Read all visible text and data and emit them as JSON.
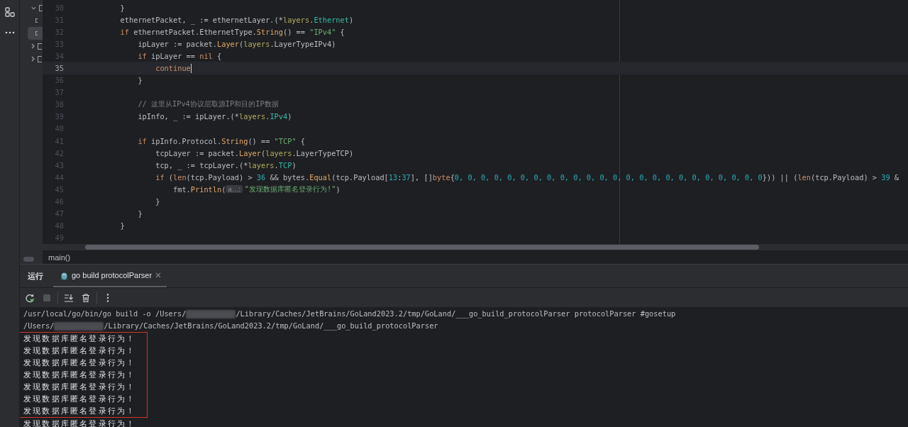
{
  "project_tree": [
    {
      "expanded": true,
      "selected": false,
      "children": [
        {
          "selected": false
        },
        {
          "selected": true
        }
      ]
    },
    {
      "expanded": false,
      "selected": false
    },
    {
      "expanded": false,
      "selected": false
    }
  ],
  "editor": {
    "lines": [
      {
        "number": "30",
        "current": false,
        "tokens": [
          {
            "kind": "plain",
            "text": "        }"
          }
        ]
      },
      {
        "number": "31",
        "current": false,
        "tokens": [
          {
            "kind": "plain",
            "text": "        ethernetPacket, _ := ethernetLayer.(*"
          },
          {
            "kind": "pkg",
            "text": "layers"
          },
          {
            "kind": "plain",
            "text": "."
          },
          {
            "kind": "type",
            "text": "Ethernet"
          },
          {
            "kind": "plain",
            "text": ")"
          }
        ]
      },
      {
        "number": "32",
        "current": false,
        "tokens": [
          {
            "kind": "kw",
            "text": "        if"
          },
          {
            "kind": "plain",
            "text": " ethernetPacket.EthernetType."
          },
          {
            "kind": "fn",
            "text": "String"
          },
          {
            "kind": "plain",
            "text": "() == "
          },
          {
            "kind": "str",
            "text": "\"IPv4\""
          },
          {
            "kind": "plain",
            "text": " {"
          }
        ]
      },
      {
        "number": "33",
        "current": false,
        "tokens": [
          {
            "kind": "plain",
            "text": "            ipLayer := packet."
          },
          {
            "kind": "fn",
            "text": "Layer"
          },
          {
            "kind": "plain",
            "text": "("
          },
          {
            "kind": "pkg",
            "text": "layers"
          },
          {
            "kind": "plain",
            "text": ".LayerTypeIPv4)"
          }
        ]
      },
      {
        "number": "34",
        "current": false,
        "tokens": [
          {
            "kind": "kw",
            "text": "            if"
          },
          {
            "kind": "plain",
            "text": " ipLayer == "
          },
          {
            "kind": "kw",
            "text": "nil"
          },
          {
            "kind": "plain",
            "text": " {"
          }
        ]
      },
      {
        "number": "35",
        "current": true,
        "tokens": [
          {
            "kind": "kw",
            "text": "                continue"
          }
        ]
      },
      {
        "number": "36",
        "current": false,
        "tokens": [
          {
            "kind": "plain",
            "text": "            }"
          }
        ]
      },
      {
        "number": "37",
        "current": false
      },
      {
        "number": "38",
        "current": false,
        "tokens": [
          {
            "kind": "comment",
            "text": "            // 这里从IPv4协议层取源IP和目的IP数据"
          }
        ]
      },
      {
        "number": "39",
        "current": false,
        "tokens": [
          {
            "kind": "plain",
            "text": "            ipInfo, _ := ipLayer.(*"
          },
          {
            "kind": "pkg",
            "text": "layers"
          },
          {
            "kind": "plain",
            "text": "."
          },
          {
            "kind": "type",
            "text": "IPv4"
          },
          {
            "kind": "plain",
            "text": ")"
          }
        ]
      },
      {
        "number": "40",
        "current": false
      },
      {
        "number": "41",
        "current": false,
        "tokens": [
          {
            "kind": "kw",
            "text": "            if"
          },
          {
            "kind": "plain",
            "text": " ipInfo.Protocol."
          },
          {
            "kind": "fn",
            "text": "String"
          },
          {
            "kind": "plain",
            "text": "() == "
          },
          {
            "kind": "str",
            "text": "\"TCP\""
          },
          {
            "kind": "plain",
            "text": " {"
          }
        ]
      },
      {
        "number": "42",
        "current": false,
        "tokens": [
          {
            "kind": "plain",
            "text": "                tcpLayer := packet."
          },
          {
            "kind": "fn",
            "text": "Layer"
          },
          {
            "kind": "plain",
            "text": "("
          },
          {
            "kind": "pkg",
            "text": "layers"
          },
          {
            "kind": "plain",
            "text": ".LayerTypeTCP)"
          }
        ]
      },
      {
        "number": "43",
        "current": false,
        "tokens": [
          {
            "kind": "plain",
            "text": "                tcp, _ := tcpLayer.(*"
          },
          {
            "kind": "pkg",
            "text": "layers"
          },
          {
            "kind": "plain",
            "text": "."
          },
          {
            "kind": "type",
            "text": "TCP"
          },
          {
            "kind": "plain",
            "text": ")"
          }
        ]
      },
      {
        "number": "44",
        "current": false,
        "tokens": [
          {
            "kind": "kw",
            "text": "                if"
          },
          {
            "kind": "plain",
            "text": " ("
          },
          {
            "kind": "kw",
            "text": "len"
          },
          {
            "kind": "plain",
            "text": "(tcp.Payload) > "
          },
          {
            "kind": "num",
            "text": "36"
          },
          {
            "kind": "plain",
            "text": " && bytes."
          },
          {
            "kind": "fn",
            "text": "Equal"
          },
          {
            "kind": "plain",
            "text": "(tcp.Payload["
          },
          {
            "kind": "num",
            "text": "13"
          },
          {
            "kind": "plain",
            "text": ":"
          },
          {
            "kind": "num",
            "text": "37"
          },
          {
            "kind": "plain",
            "text": "], []"
          },
          {
            "kind": "kw",
            "text": "byte"
          },
          {
            "kind": "plain",
            "text": "{"
          },
          {
            "kind": "num",
            "text": "0, 0, 0, 0, 0, 0, 0, 0, 0, 0, 0, 0, 0, 0, 0, 0, 0, 0, 0, 0, 0, 0, 0, 0"
          },
          {
            "kind": "plain",
            "text": "})) || ("
          },
          {
            "kind": "kw",
            "text": "len"
          },
          {
            "kind": "plain",
            "text": "(tcp.Payload) > "
          },
          {
            "kind": "num",
            "text": "39"
          },
          {
            "kind": "plain",
            "text": " &"
          }
        ]
      },
      {
        "number": "45",
        "current": false,
        "tokens": [
          {
            "kind": "plain",
            "text": "                    fmt."
          },
          {
            "kind": "fn",
            "text": "Println"
          },
          {
            "kind": "plain",
            "text": "("
          },
          {
            "kind": "hint",
            "text": "a…:"
          },
          {
            "kind": "str",
            "text": "\"发现数据库匿名登录行为!\""
          },
          {
            "kind": "plain",
            "text": ")"
          }
        ]
      },
      {
        "number": "46",
        "current": false,
        "tokens": [
          {
            "kind": "plain",
            "text": "                }"
          }
        ]
      },
      {
        "number": "47",
        "current": false,
        "tokens": [
          {
            "kind": "plain",
            "text": "            }"
          }
        ]
      },
      {
        "number": "48",
        "current": false,
        "tokens": [
          {
            "kind": "plain",
            "text": "        }"
          }
        ]
      },
      {
        "number": "49",
        "current": false
      }
    ]
  },
  "breadcrumb": "main()",
  "run_panel": {
    "title": "运行",
    "tabs": [
      {
        "label": "go build protocolParser",
        "selected": true
      }
    ],
    "toolbar": [
      {
        "kind": "rerun",
        "disabled": false
      },
      {
        "kind": "stop",
        "disabled": true
      },
      {
        "kind": "divider"
      },
      {
        "kind": "scroll-end",
        "disabled": false
      },
      {
        "kind": "trash",
        "disabled": false
      },
      {
        "kind": "divider"
      },
      {
        "kind": "more",
        "disabled": false
      }
    ],
    "console": {
      "command_lines": [
        {
          "before": "/usr/local/go/bin/go build -o /Users/",
          "after": "/Library/Caches/JetBrains/GoLand2023.2/tmp/GoLand/___go_build_protocolParser protocolParser #gosetup"
        },
        {
          "before": "/Users/",
          "after": "/Library/Caches/JetBrains/GoLand2023.2/tmp/GoLand/___go_build_protocolParser"
        }
      ],
      "boxed_output": [
        "发现数据库匿名登录行为！",
        "发现数据库匿名登录行为！",
        "发现数据库匿名登录行为！",
        "发现数据库匿名登录行为！",
        "发现数据库匿名登录行为！",
        "发现数据库匿名登录行为！",
        "发现数据库匿名登录行为！"
      ],
      "output_after": [
        "发现数据库匿名登录行为！"
      ]
    }
  }
}
